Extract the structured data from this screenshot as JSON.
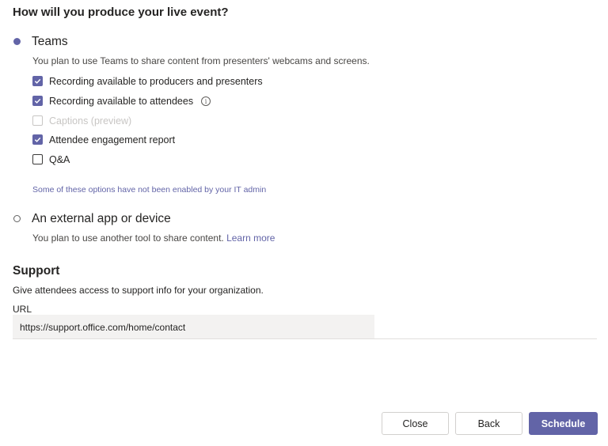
{
  "heading": "How will you produce your live event?",
  "options": {
    "teams": {
      "title": "Teams",
      "selected": true,
      "description": "You plan to use Teams to share content from presenters' webcams and screens.",
      "checkboxes": [
        {
          "label": "Recording available to producers and presenters",
          "checked": true,
          "disabled": false
        },
        {
          "label": "Recording available to attendees",
          "checked": true,
          "disabled": false,
          "info_icon": "info-icon"
        },
        {
          "label": "Captions (preview)",
          "checked": false,
          "disabled": true
        },
        {
          "label": "Attendee engagement report",
          "checked": true,
          "disabled": false
        },
        {
          "label": "Q&A",
          "checked": false,
          "disabled": false
        }
      ],
      "note": "Some of these options have not been enabled by your IT admin"
    },
    "external": {
      "title": "An external app or device",
      "selected": false,
      "description": "You plan to use another tool to share content.",
      "link": "Learn more"
    }
  },
  "support": {
    "title": "Support",
    "description": "Give attendees access to support info for your organization.",
    "url_label": "URL",
    "url_value": "https://support.office.com/home/contact"
  },
  "buttons": {
    "close": "Close",
    "back": "Back",
    "schedule": "Schedule"
  },
  "colors": {
    "accent": "#6264a7",
    "disabled": "#c8c6c4"
  }
}
